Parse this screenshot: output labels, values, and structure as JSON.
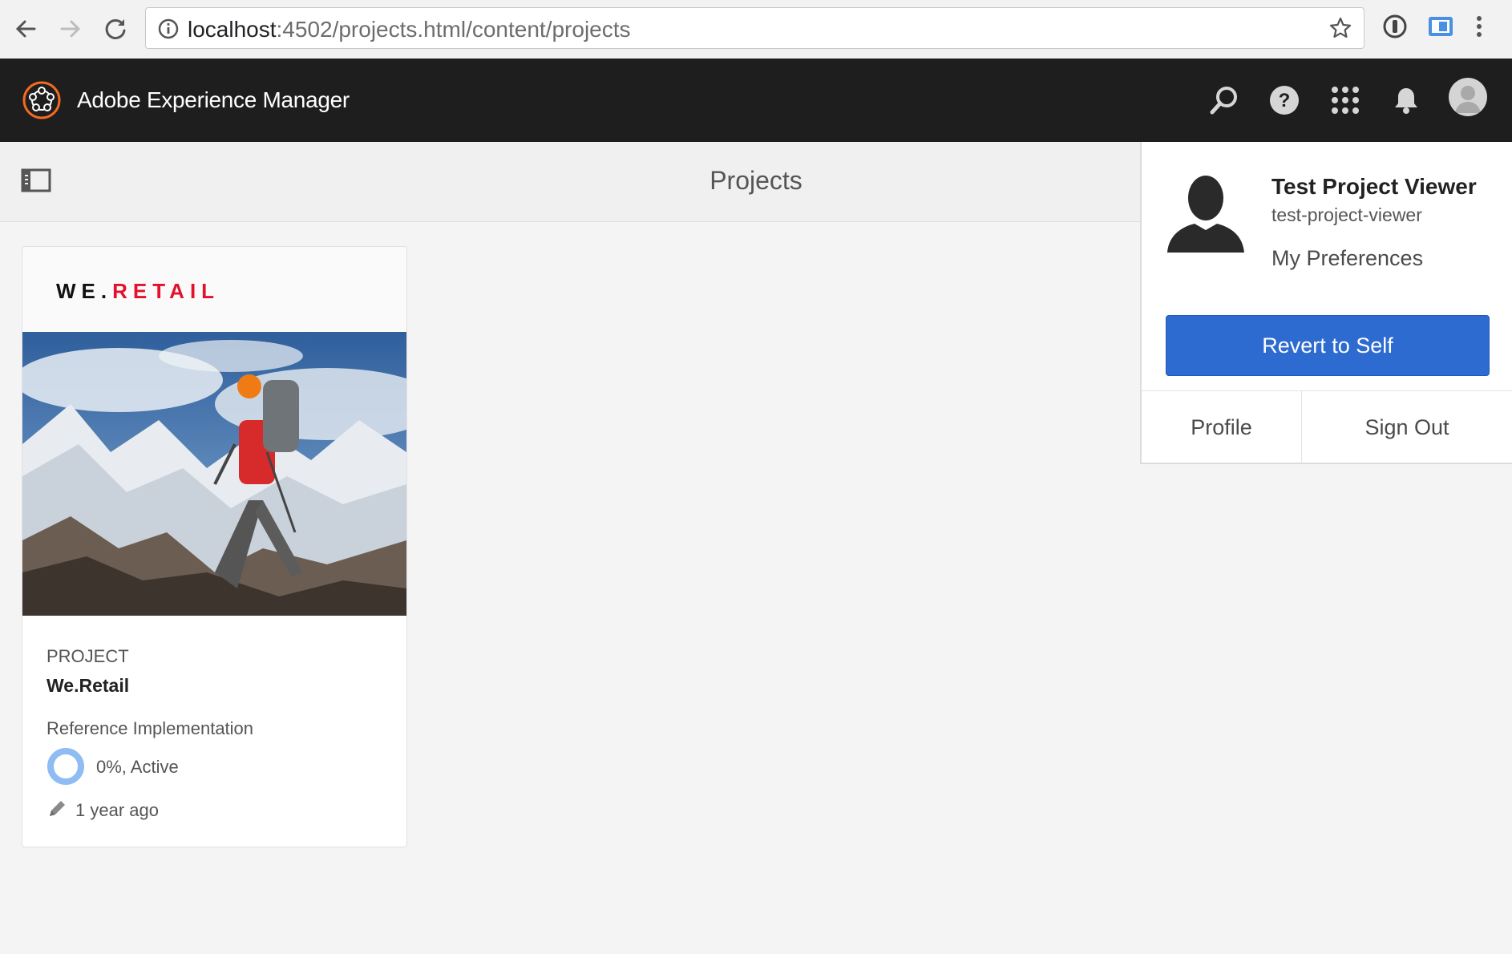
{
  "browser": {
    "url_host": "localhost",
    "url_rest": ":4502/projects.html/content/projects",
    "icons": [
      "back-icon",
      "forward-icon",
      "reload-icon",
      "info-icon",
      "star-icon",
      "password-manager-icon",
      "extension-icon",
      "menu-icon"
    ]
  },
  "header": {
    "app_title": "Adobe Experience Manager",
    "icons": [
      "search-icon",
      "help-icon",
      "apps-icon",
      "bell-icon",
      "avatar"
    ]
  },
  "actionbar": {
    "page_title": "Projects"
  },
  "card": {
    "logo_we": "WE.",
    "logo_retail": "RETAIL",
    "kind": "PROJECT",
    "name": "We.Retail",
    "description": "Reference Implementation",
    "progress": 0,
    "status": "0%, Active",
    "modified": "1 year ago"
  },
  "user_popover": {
    "display_name": "Test Project Viewer",
    "username": "test-project-viewer",
    "preferences_label": "My Preferences",
    "revert_label": "Revert to Self",
    "profile_label": "Profile",
    "signout_label": "Sign Out"
  },
  "colors": {
    "header_bg": "#1e1e1e",
    "accent_blue": "#2d6bd0",
    "brand_red": "#e3112b",
    "progress_blue": "#8fbcf2"
  }
}
